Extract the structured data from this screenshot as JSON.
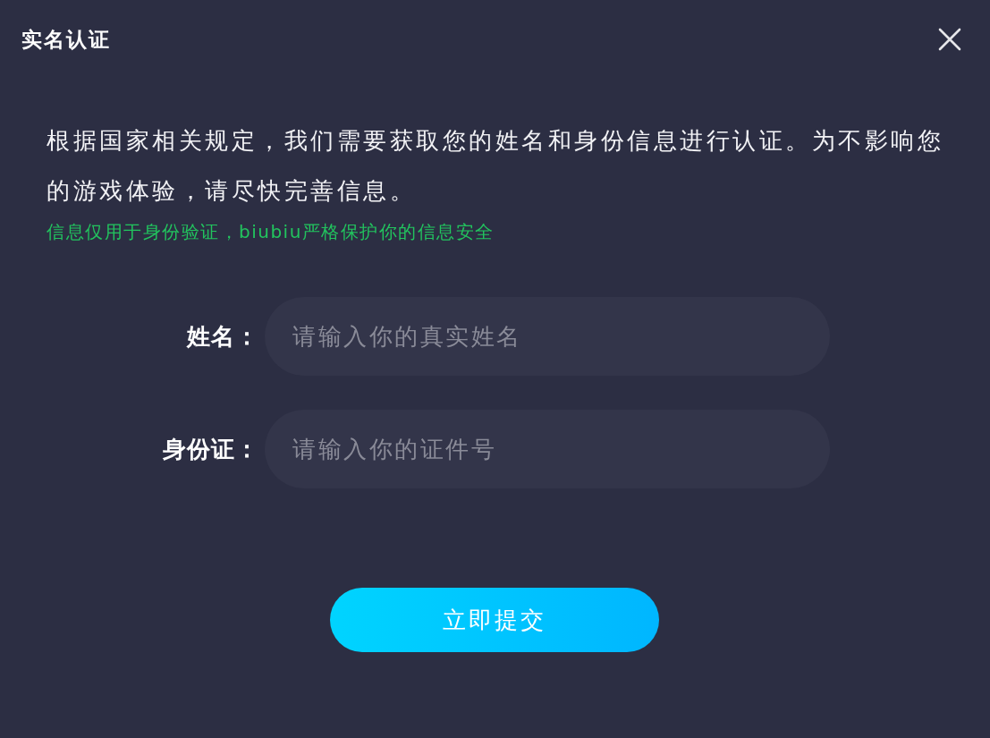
{
  "window": {
    "title": "实名认证"
  },
  "notice": "根据国家相关规定，我们需要获取您的姓名和身份信息进行认证。为不影响您的游戏体验，请尽快完善信息。",
  "privacy_note": "信息仅用于身份验证，biubiu严格保护你的信息安全",
  "fields": [
    {
      "label": "姓名：",
      "placeholder": "请输入你的真实姓名"
    },
    {
      "label": "身份证：",
      "placeholder": "请输入你的证件号"
    }
  ],
  "buttons": [
    "立即提交"
  ]
}
